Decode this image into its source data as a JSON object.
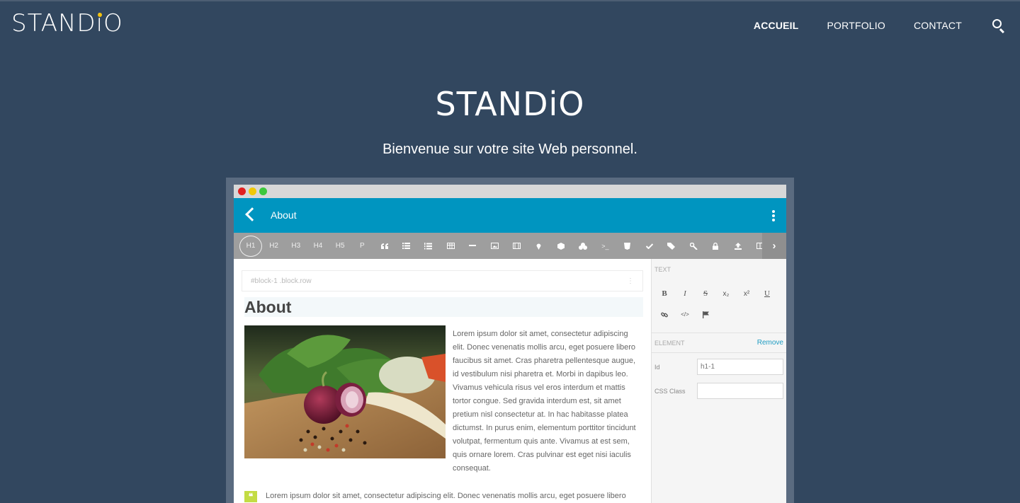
{
  "site": {
    "logo": "STANDiO",
    "logo_parts": [
      "STAND",
      "i",
      "O"
    ],
    "nav": [
      "ACCUEIL",
      "PORTFOLIO",
      "CONTACT"
    ],
    "search_icon": "search-icon"
  },
  "hero": {
    "title": "STANDiO",
    "subtitle": "Bienvenue sur votre site Web personnel."
  },
  "mockup": {
    "window_buttons": [
      "#e02020",
      "#f0c808",
      "#3cc83c"
    ],
    "appbar_title": "About",
    "toolbar": {
      "text_items": [
        "H1",
        "H2",
        "H3",
        "H4",
        "H5",
        "P"
      ],
      "icon_items": [
        "quote-icon",
        "bullet-list-icon",
        "numbered-list-icon",
        "table-icon",
        "horizontal-rule-icon",
        "image-icon",
        "video-icon",
        "map-pin-icon",
        "box-icon",
        "shapes-icon",
        "terminal-icon",
        "html5-icon",
        "check-icon",
        "tags-icon",
        "key-icon",
        "lock-icon",
        "upload-icon",
        "columns-icon"
      ],
      "more": "›"
    },
    "block_selector": "#block-1 .block.row",
    "heading": "About",
    "paragraph": "Lorem ipsum dolor sit amet, consectetur adipiscing elit. Donec venenatis mollis arcu, eget posuere libero faucibus sit amet. Cras pharetra pellentesque augue, id vestibulum nisi pharetra et. Morbi in dapibus leo. Vivamus vehicula risus vel eros interdum et mattis tortor congue. Sed gravida interdum est, sit amet pretium nisl consectetur at. In hac habitasse platea dictumst. In purus enim, elementum porttitor tincidunt volutpat, fermentum quis ante. Vivamus at est sem, quis ornare lorem. Cras pulvinar est eget nisi iaculis consequat.",
    "quote_badge": "❝",
    "quote_text": "Lorem ipsum dolor sit amet, consectetur adipiscing elit. Donec venenatis mollis arcu, eget posuere libero",
    "panel": {
      "text_label": "TEXT",
      "format_buttons": [
        "B",
        "I",
        "S",
        "x₂",
        "x²",
        "U"
      ],
      "format_icons": [
        "link-icon",
        "code-icon",
        "flag-icon"
      ],
      "element_label": "ELEMENT",
      "remove": "Remove",
      "id_label": "Id",
      "id_value": "h1-1",
      "class_label": "CSS Class",
      "class_value": ""
    }
  },
  "colors": {
    "page_bg": "#32475f",
    "appbar": "#0095c0",
    "toolbar": "#9e9e9e",
    "quote_badge": "#c3dc44",
    "link": "#1e9cc2",
    "logo_dot": "#f4c20d"
  }
}
